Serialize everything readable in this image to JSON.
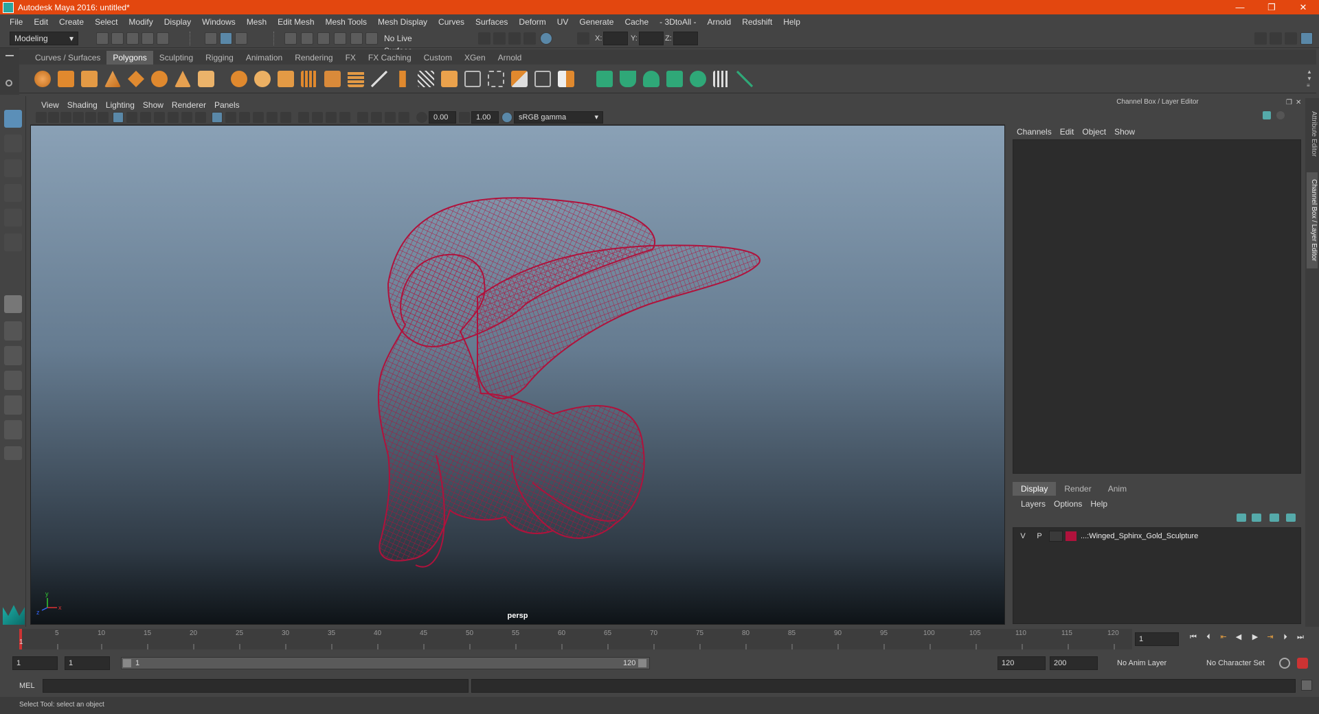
{
  "window": {
    "title": "Autodesk Maya 2016: untitled*",
    "minimize": "—",
    "restore": "❐",
    "close": "✕"
  },
  "menubar": [
    "File",
    "Edit",
    "Create",
    "Select",
    "Modify",
    "Display",
    "Windows",
    "Mesh",
    "Edit Mesh",
    "Mesh Tools",
    "Mesh Display",
    "Curves",
    "Surfaces",
    "Deform",
    "UV",
    "Generate",
    "Cache",
    "- 3DtoAll -",
    "Arnold",
    "Redshift",
    "Help"
  ],
  "statusline": {
    "menuset": "Modeling",
    "live_surface": "No Live Surface",
    "x_label": "X:",
    "y_label": "Y:",
    "z_label": "Z:"
  },
  "shelf_tabs": [
    "Curves / Surfaces",
    "Polygons",
    "Sculpting",
    "Rigging",
    "Animation",
    "Rendering",
    "FX",
    "FX Caching",
    "Custom",
    "XGen",
    "Arnold"
  ],
  "shelf_active": "Polygons",
  "viewport": {
    "menu": [
      "View",
      "Shading",
      "Lighting",
      "Show",
      "Renderer",
      "Panels"
    ],
    "exposure": "0.00",
    "gamma": "1.00",
    "color_space": "sRGB gamma",
    "camera_label": "persp",
    "axis_y": "y",
    "axis_x": "x",
    "axis_z": "z",
    "model_color": "#b0123c"
  },
  "channel_box": {
    "title": "Channel Box / Layer Editor",
    "menu": [
      "Channels",
      "Edit",
      "Object",
      "Show"
    ]
  },
  "layer_editor": {
    "tabs": [
      "Display",
      "Render",
      "Anim"
    ],
    "active_tab": "Display",
    "menu": [
      "Layers",
      "Options",
      "Help"
    ],
    "layers": [
      {
        "v": "V",
        "p": "P",
        "name": "...:Winged_Sphinx_Gold_Sculpture",
        "color": "#b0123c"
      }
    ]
  },
  "side_tabs": [
    "Attribute Editor",
    "Channel Box / Layer Editor"
  ],
  "timeline": {
    "ticks": [
      "1",
      "5",
      "10",
      "15",
      "20",
      "25",
      "30",
      "35",
      "40",
      "45",
      "50",
      "55",
      "60",
      "65",
      "70",
      "75",
      "80",
      "85",
      "90",
      "95",
      "100",
      "105",
      "110",
      "115",
      "120"
    ],
    "current_frame": "1"
  },
  "range": {
    "start": "1",
    "playback_start": "1",
    "slider_start": "1",
    "slider_end": "120",
    "playback_end": "120",
    "end": "200",
    "anim_layer": "No Anim Layer",
    "character_set": "No Character Set"
  },
  "command": {
    "label": "MEL"
  },
  "help_line": "Select Tool: select an object"
}
